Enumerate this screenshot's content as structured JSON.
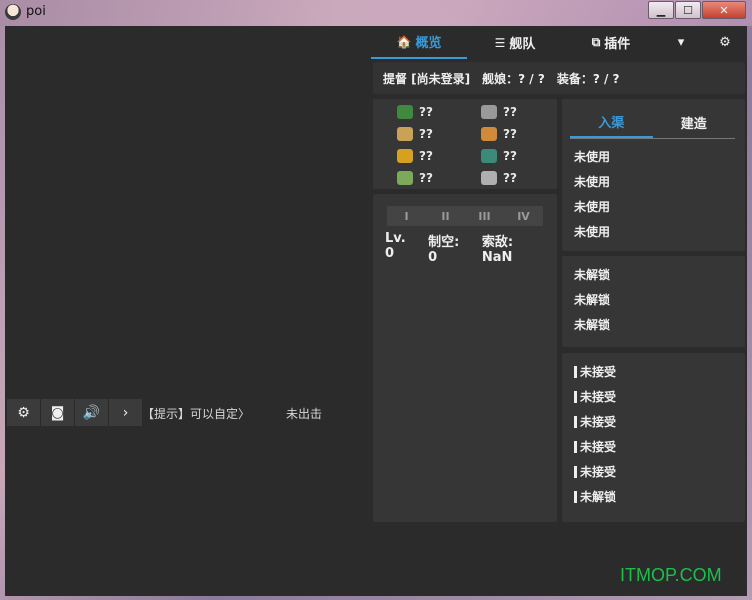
{
  "window": {
    "title": "poi"
  },
  "window_buttons": {
    "minimize": "▁",
    "maximize": "☐",
    "close": "✕"
  },
  "toolbar": {
    "settings_icon": "⚙",
    "screenshot_icon": "◙",
    "volume_icon": "🔊",
    "expand_icon": "›"
  },
  "game": {
    "tip": "【提示】可以自定〉",
    "status": "未出击"
  },
  "nav": {
    "tabs": [
      {
        "icon": "🏠",
        "label": "概览"
      },
      {
        "icon": "☰",
        "label": "舰队"
      },
      {
        "icon": "⧉",
        "label": "插件"
      }
    ],
    "dropdown_icon": "▾",
    "settings_icon": "⚙"
  },
  "admiral": {
    "name": "提督 [尚未登录]",
    "ships": "舰娘：? / ?",
    "equips": "装备：? / ?"
  },
  "resources": [
    {
      "value": "??",
      "color": "#3f8a3f"
    },
    {
      "value": "??",
      "color": "#9a9a9a"
    },
    {
      "value": "??",
      "color": "#c9a256"
    },
    {
      "value": "??",
      "color": "#d08a3a"
    },
    {
      "value": "??",
      "color": "#d6a020"
    },
    {
      "value": "??",
      "color": "#3c8a7a"
    },
    {
      "value": "??",
      "color": "#7aaa5a"
    },
    {
      "value": "??",
      "color": "#b0b0b0"
    }
  ],
  "fleet": {
    "tabs": [
      "I",
      "II",
      "III",
      "IV"
    ],
    "level": "Lv. 0",
    "air": "制空: 0",
    "los": "索敌: NaN"
  },
  "dock": {
    "tabs": [
      "入渠",
      "建造"
    ],
    "items": [
      "未使用",
      "未使用",
      "未使用",
      "未使用"
    ]
  },
  "locked": {
    "items": [
      "未解锁",
      "未解锁",
      "未解锁"
    ]
  },
  "expedition": {
    "items": [
      "未接受",
      "未接受",
      "未接受",
      "未接受",
      "未接受",
      "未解锁"
    ]
  },
  "watermark": "ITMOP.COM"
}
